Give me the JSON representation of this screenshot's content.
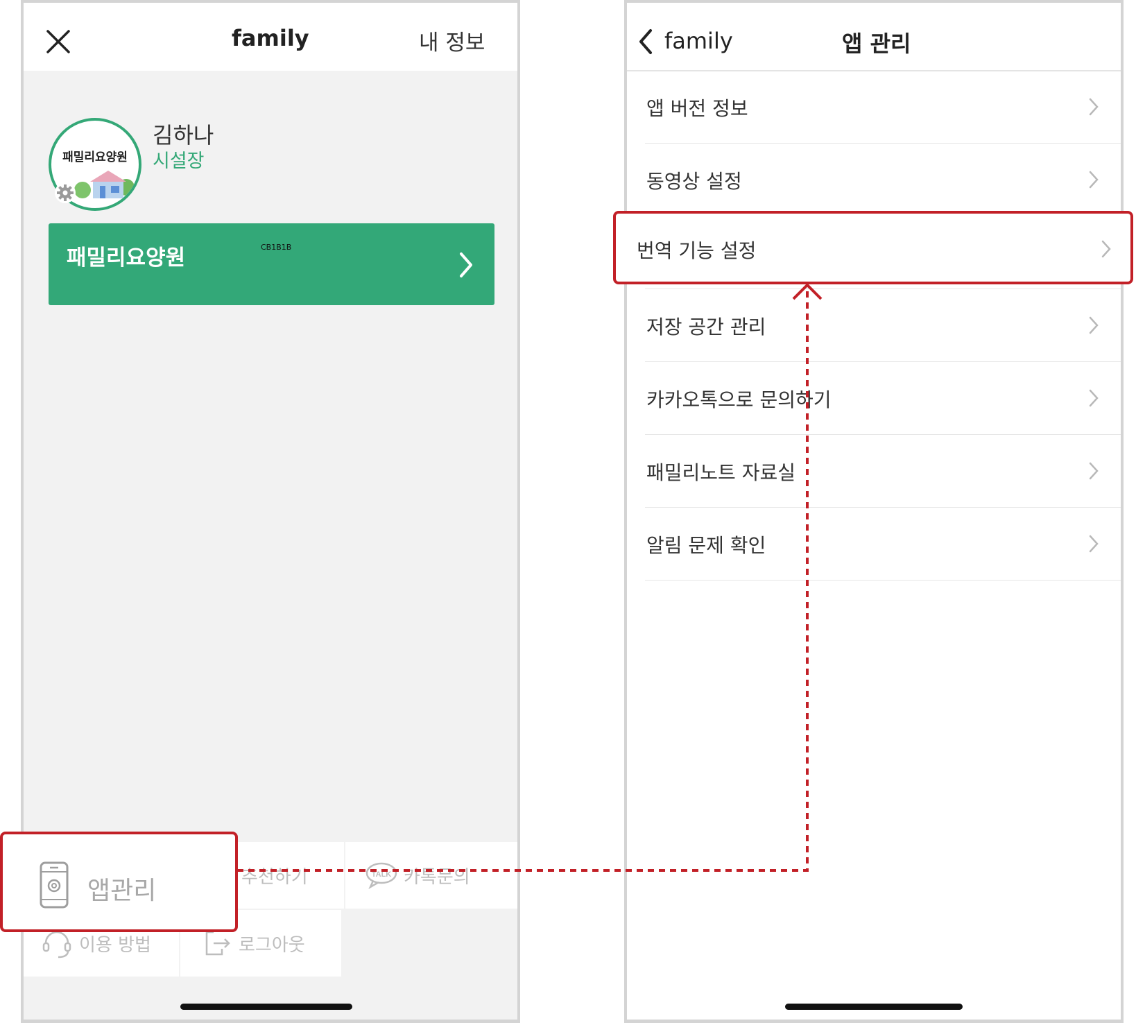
{
  "left_screen": {
    "header": {
      "title": "family",
      "right_link": "내 정보",
      "close_icon": "close-icon"
    },
    "profile": {
      "avatar_text": "패밀리요양원",
      "name": "김하나",
      "role": "시설장"
    },
    "facility_card": {
      "name": "패밀리요양원",
      "code": "CB1B1B"
    },
    "bottom_menu": {
      "app_manage": "앱관리",
      "recommend": "추천하기",
      "talk_inquiry": "카톡문의",
      "talk_badge": "TALK",
      "how_to_use": "이용 방법",
      "logout": "로그아웃"
    }
  },
  "right_screen": {
    "header": {
      "back_label": "family",
      "title": "앱 관리"
    },
    "menu_items": [
      {
        "label": "앱 버전 정보"
      },
      {
        "label": "동영상 설정"
      },
      {
        "label": "번역 기능 설정"
      },
      {
        "label": "저장 공간 관리"
      },
      {
        "label": "카카오톡으로 문의하기"
      },
      {
        "label": "패밀리노트 자료실"
      },
      {
        "label": "알림 문제 확인"
      }
    ]
  },
  "colors": {
    "brand_green": "#33a878",
    "highlight_red": "#c22027",
    "menu_text": "#333333",
    "muted_text": "#bdbdbd"
  }
}
